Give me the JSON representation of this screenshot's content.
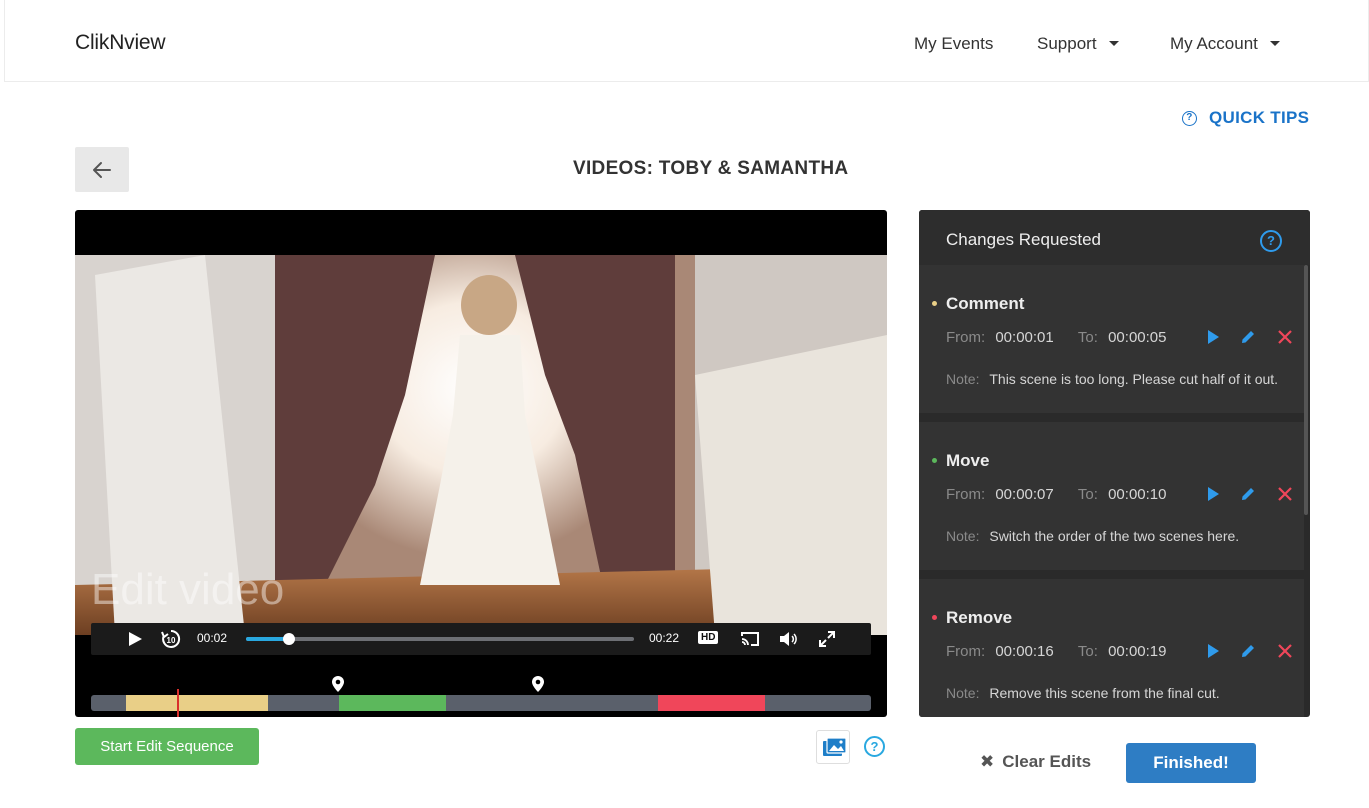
{
  "nav": {
    "brand": "ClikNview",
    "items": [
      {
        "label": "My Events"
      },
      {
        "label": "Support"
      },
      {
        "label": "My Account"
      }
    ]
  },
  "quick_tips": "QUICK TIPS",
  "page_title": "VIDEOS: TOBY & SAMANTHA",
  "video": {
    "watermark": "Edit video",
    "current_time": "00:02",
    "duration": "00:22",
    "hd_label": "HD",
    "progress_fraction": 0.11
  },
  "timeline": {
    "segments": [
      {
        "start_fraction": 0.045,
        "end_fraction": 0.227,
        "color": "#e9cf87"
      },
      {
        "start_fraction": 0.318,
        "end_fraction": 0.455,
        "color": "#5cb85c"
      },
      {
        "start_fraction": 0.727,
        "end_fraction": 0.864,
        "color": "#f0465a"
      }
    ],
    "playhead_fraction": 0.11
  },
  "buttons": {
    "start_edit": "Start Edit Sequence",
    "clear_edits": "Clear Edits",
    "finished": "Finished!"
  },
  "changes": {
    "title": "Changes Requested",
    "from_label": "From:",
    "to_label": "To:",
    "note_label": "Note:",
    "items": [
      {
        "type": "Comment",
        "color": "#e9cf87",
        "from": "00:00:01",
        "to": "00:00:05",
        "note": "This scene is too long. Please cut half of it out."
      },
      {
        "type": "Move",
        "color": "#5cb85c",
        "from": "00:00:07",
        "to": "00:00:10",
        "note": "Switch the order of the two scenes here."
      },
      {
        "type": "Remove",
        "color": "#f0465a",
        "from": "00:00:16",
        "to": "00:00:19",
        "note": "Remove this scene from the final cut."
      }
    ]
  },
  "icons": [
    "back-arrow-icon",
    "help-icon",
    "play-icon",
    "rewind-10-icon",
    "cast-icon",
    "volume-icon",
    "fullscreen-icon",
    "location-pin-icon",
    "media-gallery-icon",
    "edit-pencil-icon",
    "delete-x-icon"
  ]
}
